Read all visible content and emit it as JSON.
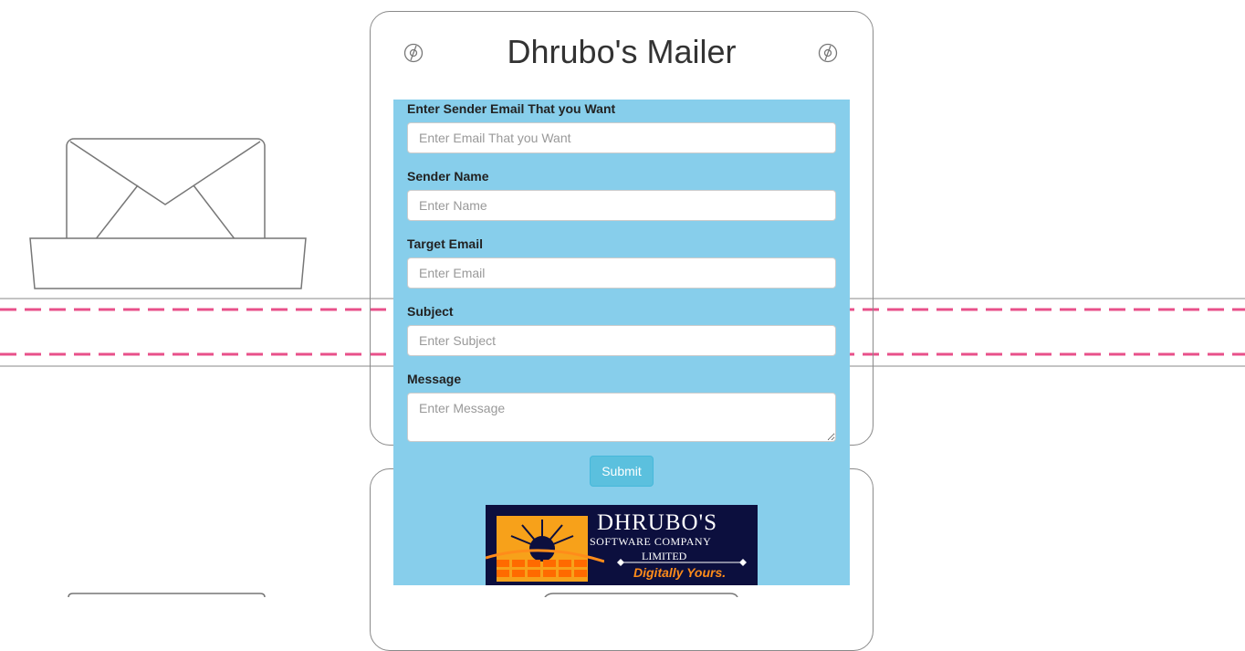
{
  "app": {
    "title": "Dhrubo's Mailer"
  },
  "form": {
    "sender_email": {
      "label": "Enter Sender Email That you Want",
      "placeholder": "Enter Email That you Want",
      "value": ""
    },
    "sender_name": {
      "label": "Sender Name",
      "placeholder": "Enter Name",
      "value": ""
    },
    "target_email": {
      "label": "Target Email",
      "placeholder": "Enter Email",
      "value": ""
    },
    "subject": {
      "label": "Subject",
      "placeholder": "Enter Subject",
      "value": ""
    },
    "message": {
      "label": "Message",
      "placeholder": "Enter Message",
      "value": ""
    },
    "submit_label": "Submit"
  },
  "logo": {
    "line1": "DHRUBO'S",
    "line2": "SOFTWARE COMPANY",
    "line3": "LIMITED",
    "tagline": "Digitally Yours."
  },
  "colors": {
    "panel": "#87ceeb",
    "button": "#5bc0de",
    "dashed_line": "#e8508a",
    "logo_bg": "#0c0f3e",
    "logo_accent": "#ff8c1a"
  },
  "icons": {
    "left_corner": "target-icon",
    "right_corner": "target-icon",
    "envelope": "envelope-icon"
  }
}
